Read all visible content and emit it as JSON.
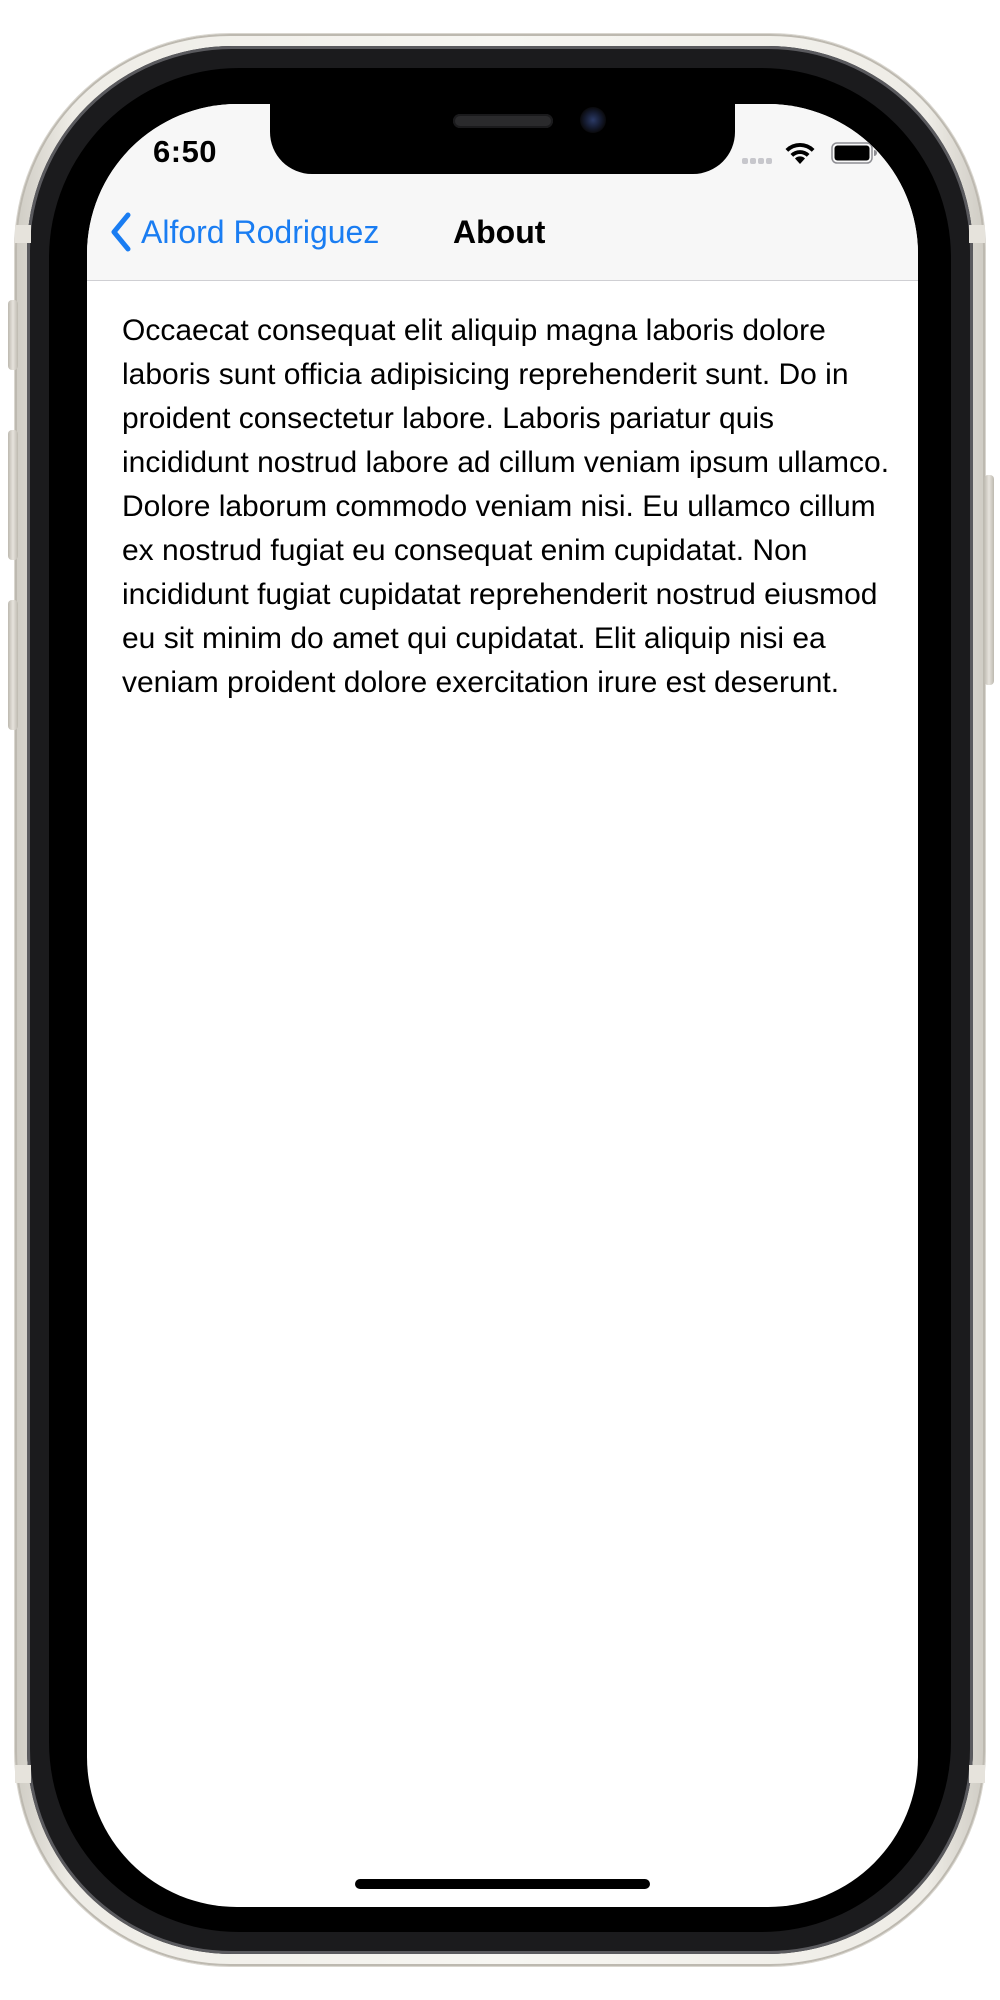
{
  "status_bar": {
    "time": "6:50"
  },
  "nav_bar": {
    "back_label": "Alford Rodriguez",
    "title": "About"
  },
  "content": {
    "body_text": "Occaecat consequat elit aliquip magna laboris dolore laboris sunt officia adipisicing reprehenderit sunt. Do in proident consectetur labore. Laboris pariatur quis incididunt nostrud labore ad cillum veniam ipsum ullamco. Dolore laborum commodo veniam nisi. Eu ullamco cillum ex nostrud fugiat eu consequat enim cupidatat. Non incididunt fugiat cupidatat reprehenderit nostrud eiusmod eu sit minim do amet qui cupidatat. Elit aliquip nisi ea veniam proident dolore exercitation irure est deserunt."
  },
  "icons": {
    "back": "chevron-left-icon",
    "signal": "cellular-signal-icon",
    "wifi": "wifi-icon",
    "battery": "battery-icon"
  },
  "colors": {
    "accent": "#1a7df2",
    "nav_background": "#f7f7f7",
    "text": "#000000"
  }
}
